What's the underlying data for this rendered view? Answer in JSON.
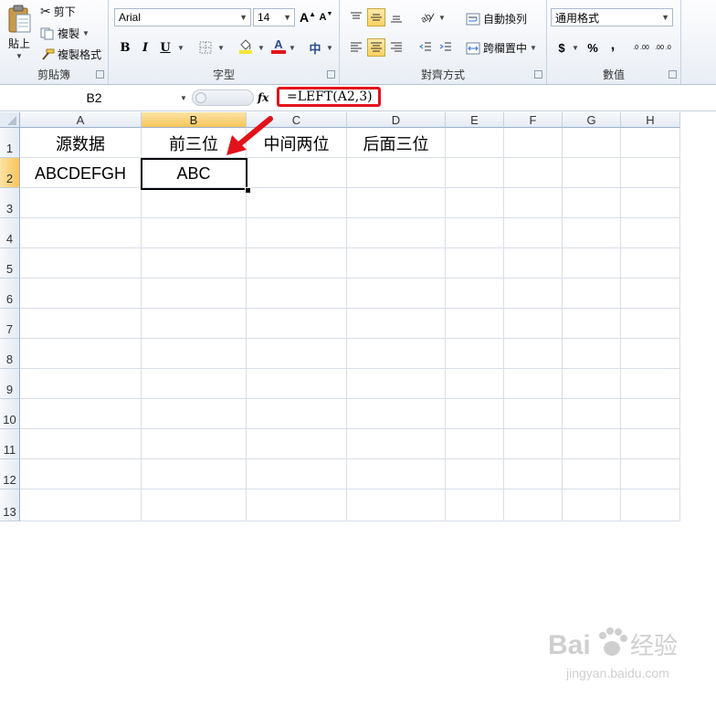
{
  "ribbon": {
    "clipboard": {
      "paste_label": "貼上",
      "cut_label": "剪下",
      "copy_label": "複製",
      "format_painter_label": "複製格式",
      "group_label": "剪貼簿"
    },
    "font": {
      "font_name": "Arial",
      "font_size": "14",
      "bold": "B",
      "italic": "I",
      "underline": "U",
      "grow": "A",
      "shrink": "A",
      "font_color_glyph": "A",
      "phonetic_glyph": "中",
      "group_label": "字型",
      "font_color": "#e3121a",
      "fill_color": "#f5e63a"
    },
    "alignment": {
      "wrap_label": "自動換列",
      "merge_label": "跨欄置中",
      "group_label": "對齊方式"
    },
    "number": {
      "format_value": "通用格式",
      "currency": "$",
      "percent": "%",
      "comma": ",",
      "inc_decimal": ".0 .00",
      "dec_decimal": ".00 .0",
      "group_label": "數值"
    }
  },
  "formula_bar": {
    "name_box": "B2",
    "fx": "fx",
    "formula": "=LEFT(A2,3)",
    "highlight_color": "#e3121a"
  },
  "sheet": {
    "columns": [
      "A",
      "B",
      "C",
      "D",
      "E",
      "F",
      "G",
      "H"
    ],
    "rows": [
      "1",
      "2",
      "3",
      "4",
      "5",
      "6",
      "7",
      "8",
      "9",
      "10",
      "11",
      "12",
      "13"
    ],
    "selected_cell": "B2",
    "cells": {
      "A1": "源数据",
      "B1": "前三位",
      "C1": "中间两位",
      "D1": "后面三位",
      "A2": "ABCDEFGH",
      "B2": "ABC"
    }
  },
  "annotation": {
    "arrow_color": "#e3121a"
  },
  "watermark": {
    "brand": "Bai",
    "brand_cn": "经验",
    "url": "jingyan.baidu.com"
  }
}
